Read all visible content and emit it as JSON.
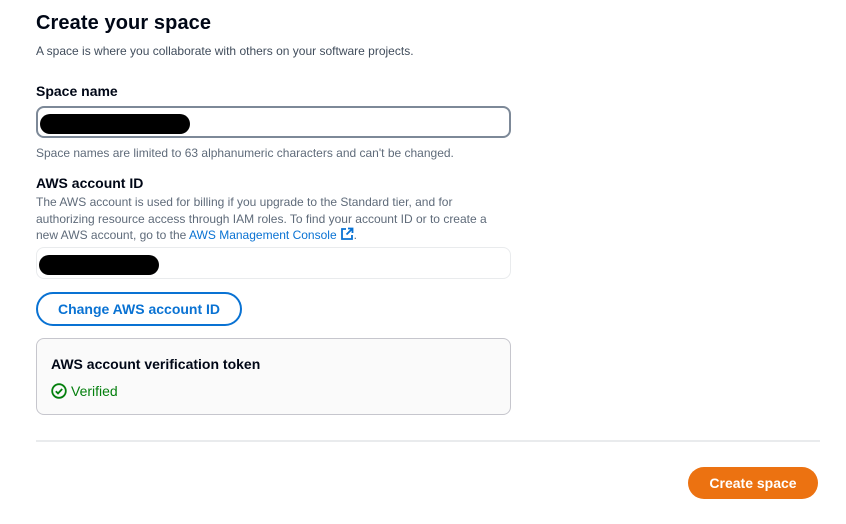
{
  "header": {
    "title": "Create your space",
    "description": "A space is where you collaborate with others on your software projects."
  },
  "space_name": {
    "label": "Space name",
    "value_redacted": true,
    "constraint": "Space names are limited to 63 alphanumeric characters and can't be changed."
  },
  "aws_account": {
    "label": "AWS account ID",
    "description_before_link": "The AWS account is used for billing if you upgrade to the Standard tier, and for authorizing resource access through IAM roles. To find your account ID or to create a new AWS account, go to the ",
    "link_text": "AWS Management Console",
    "description_after_link": ".",
    "value_redacted": true,
    "change_button": "Change AWS account ID"
  },
  "verification": {
    "title": "AWS account verification token",
    "status": "Verified",
    "status_color": "#037f0c"
  },
  "footer": {
    "create_button": "Create space",
    "create_button_color": "#ec7211"
  },
  "icons": {
    "external_link": "external-link-icon",
    "verified": "check-circle-icon"
  }
}
